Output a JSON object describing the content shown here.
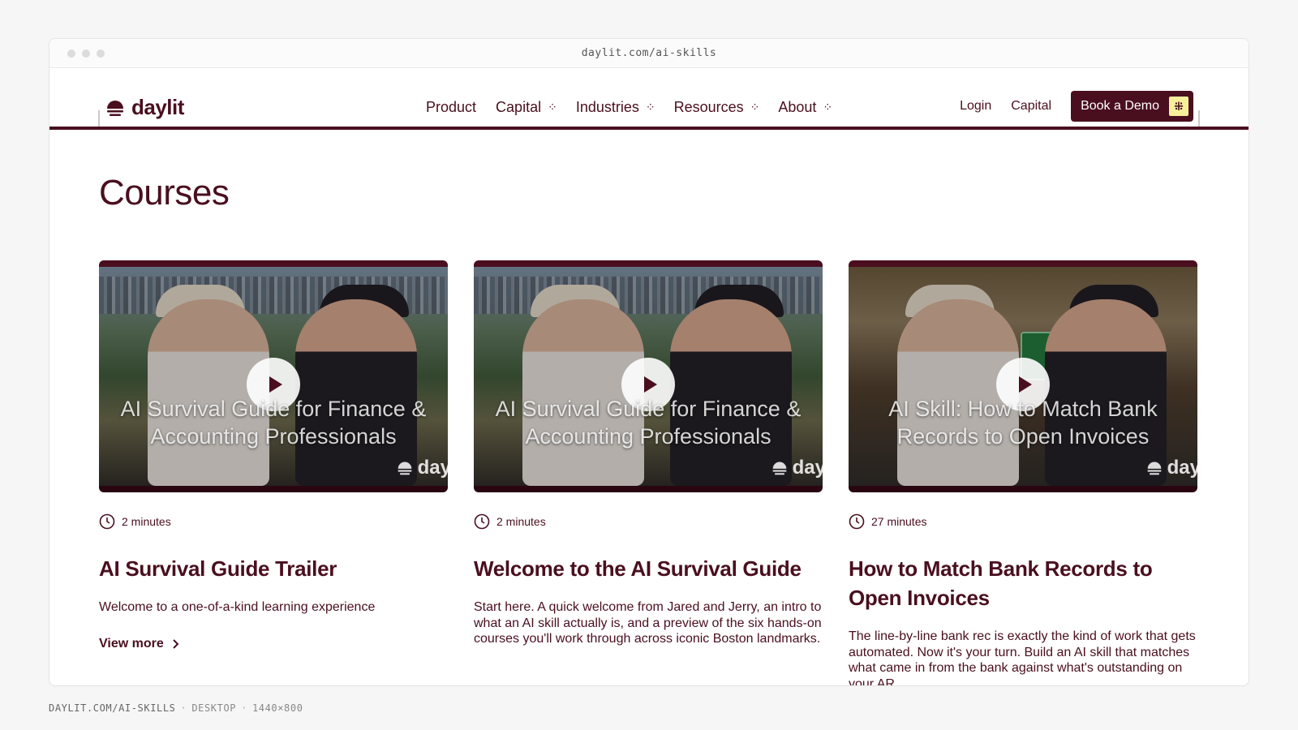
{
  "browser": {
    "url": "daylit.com/ai-skills"
  },
  "header": {
    "logo_text": "daylit",
    "menu": [
      {
        "label": "Product",
        "has_dropdown": false
      },
      {
        "label": "Capital",
        "has_dropdown": true
      },
      {
        "label": "Industries",
        "has_dropdown": true
      },
      {
        "label": "Resources",
        "has_dropdown": true
      },
      {
        "label": "About",
        "has_dropdown": true
      }
    ],
    "login_label": "Login",
    "capital_label": "Capital",
    "demo_label": "Book a Demo"
  },
  "page": {
    "title": "Courses"
  },
  "courses": [
    {
      "thumb_title": "AI Survival Guide for Finance & Accounting Professionals",
      "thumb_logo": "day",
      "duration": "2 minutes",
      "title": "AI Survival Guide Trailer",
      "description": "Welcome to a one-of-a-kind learning experience",
      "link": "View more"
    },
    {
      "thumb_title": "AI Survival Guide for Finance & Accounting Professionals",
      "thumb_logo": "day",
      "duration": "2 minutes",
      "title": "Welcome to the AI Survival Guide",
      "description": "Start here. A quick welcome from Jared and Jerry, an intro to what an AI skill actually is, and a preview of the six hands-on courses you'll work through across iconic Boston landmarks."
    },
    {
      "thumb_title": "AI Skill: How to Match Bank Records to Open Invoices",
      "thumb_logo": "day",
      "duration": "27 minutes",
      "title": "How to Match Bank Records to Open Invoices",
      "description": "The line-by-line bank rec is exactly the kind of work that gets automated. Now it's your turn. Build an AI skill that matches what came in from the bank against what's outstanding on your AR."
    }
  ],
  "footer": {
    "url": "DAYLIT.COM/AI-SKILLS",
    "device": "DESKTOP",
    "size": "1440×800"
  },
  "colors": {
    "brand": "#4a0f1f",
    "accent": "#f7ef9a"
  }
}
